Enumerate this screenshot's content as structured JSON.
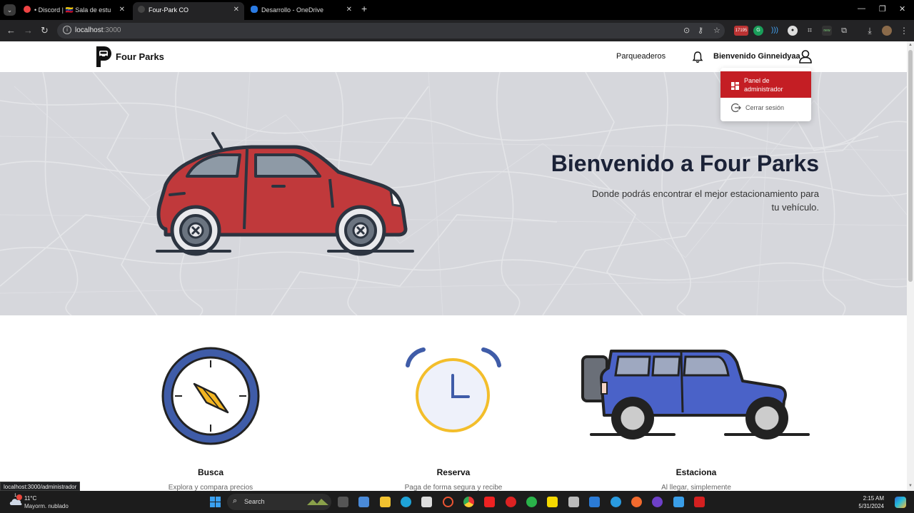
{
  "browser": {
    "tabs": [
      {
        "title": "• Discord | 🇻🇪 Sala de estu",
        "active": false
      },
      {
        "title": "Four-Park CO",
        "active": true
      },
      {
        "title": "Desarrollo - OneDrive",
        "active": false
      }
    ],
    "url_host": "localhost",
    "url_port": ":3000",
    "extension_badge": "17195",
    "extension_new": "new"
  },
  "navbar": {
    "brand": "Four Parks",
    "link": "Parqueaderos",
    "welcome": "Bienvenido Ginneidyaa"
  },
  "dropdown": {
    "admin_label": "Panel de administrador",
    "logout_label": "Cerrar sesión"
  },
  "hero": {
    "title": "Bienvenido a Four Parks",
    "subtitle": "Donde podrás encontrar el mejor estacionamiento para tu vehículo."
  },
  "features": [
    {
      "title": "Busca",
      "desc": "Explora y compara precios"
    },
    {
      "title": "Reserva",
      "desc": "Paga de forma segura y recibe"
    },
    {
      "title": "Estaciona",
      "desc": "Al llegar, simplemente"
    }
  ],
  "status_link": "localhost:3000/administrador",
  "taskbar": {
    "weather_temp": "11°C",
    "weather_desc": "Mayorm. nublado",
    "weather_badge": "1",
    "search_label": "Search",
    "time": "2:15 AM",
    "date": "5/31/2024"
  },
  "colors": {
    "accent_red": "#c41e24",
    "hero_bg": "#d6d7dc",
    "title_navy": "#1b2237"
  }
}
